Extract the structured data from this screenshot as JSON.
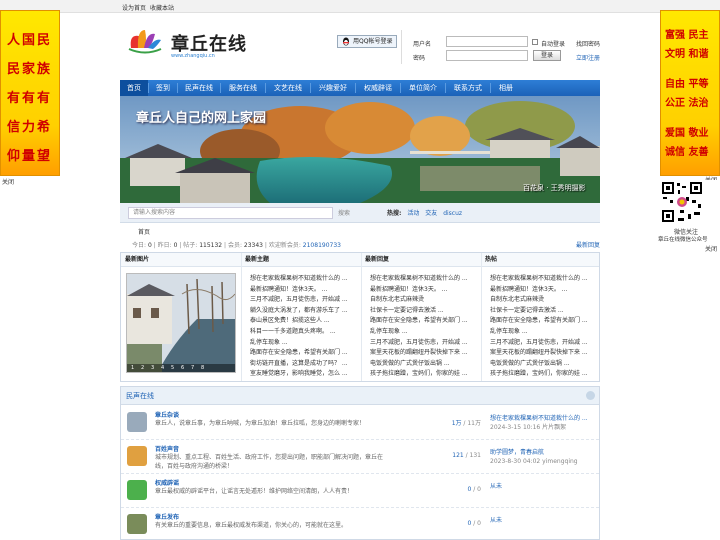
{
  "topbar": {
    "set_home": "设为首页",
    "bookmark": "收藏本站"
  },
  "ad_left": {
    "lines": [
      "人国民",
      "民家族",
      "有有有",
      "信力希",
      "仰量望"
    ],
    "close": "关闭"
  },
  "ad_right": {
    "lines": [
      "富强 民主",
      "文明 和谐",
      "自由 平等",
      "公正 法治",
      "爱国 敬业",
      "诚信 友善"
    ],
    "close": "关闭"
  },
  "logo": {
    "name": "章丘在线",
    "url": "www.zhangqiu.cn"
  },
  "login": {
    "qq_button": "用QQ帐号登录",
    "username_label": "用户名",
    "password_label": "密码",
    "auto_login": "自动登录",
    "find_password": "找回密码",
    "login_button": "登录",
    "register": "立即注册"
  },
  "nav": [
    "首页",
    "签到",
    "民声在线",
    "服务在线",
    "文艺在线",
    "兴趣爱好",
    "权威辟谣",
    "单位简介",
    "联系方式",
    "相册"
  ],
  "banner": {
    "title": "章丘人自己的网上家园",
    "caption": "百花泉 · 王秀明摄影"
  },
  "search": {
    "placeholder": "请输入搜索内容",
    "button": "搜索",
    "hot_label": "热搜:",
    "hot": [
      "活动",
      "交友",
      "discuz"
    ]
  },
  "breadcrumb": "首页",
  "stats": {
    "today_label": "今日:",
    "today": "0",
    "yesterday_label": "昨日:",
    "yesterday": "0",
    "posts_label": "帖子:",
    "posts": "115132",
    "members_label": "会员:",
    "members": "23343",
    "welcome_label": "欢迎新会员:",
    "newest": "2108190733"
  },
  "latest_reply_link": "最新回复",
  "panel": {
    "col1": "最新图片",
    "col2": "最新主题",
    "col3": "最新回复",
    "col4": "热帖",
    "pager": [
      "1",
      "2",
      "3",
      "4",
      "5",
      "6",
      "7",
      "8"
    ],
    "topics": [
      "想在老家栽棵果树不知道栽什么的 ...",
      "最新招聘通知！连休3天。 ...",
      "三月不减肥，五月徒伤悲，开始减 ...",
      "躺久没庭大涡发了，都有游乐车了 ...",
      "泰山景区免费！招揽这些人 ...",
      "科目一一千多道题真头疼啊。 ...",
      "乱停车现象 ...",
      "路面存在安全隐患，希望有关部门 ...",
      "街坊链开直播，这算是成功了吗？ ...",
      "室友睡觉磨牙，影响我睡觉，怎么 ..."
    ],
    "replies": [
      "想在老家栽棵果树不知道栽什么的 ...",
      "最新招聘通知！连休3天。 ...",
      "自制东北老式麻辣烫",
      "社保卡一定要记得去激活 ...",
      "路面存在安全隐患，希望有关部门 ...",
      "乱停车现象 ...",
      "三月不减肥，五月徒伤悲，开始减 ...",
      "案里天花板的蹋翻纽丹裂快掉下来 ...",
      "电饭煲做的广式煲仔饭出锅 ...",
      "孩子拖拉磨蹭，宝妈们，你家的娃 ..."
    ],
    "hot": [
      "想在老家栽棵果树不知道栽什么的 ...",
      "最新招聘通知！连休3天。 ...",
      "自制东北老式麻辣烫",
      "社保卡一定要记得去激活 ...",
      "路面存在安全隐患，希望有关部门 ...",
      "乱停车现象 ...",
      "三月不减肥，五月徒伤悲，开始减 ...",
      "案里天花板的蹋翻纽丹裂快掉下来 ...",
      "电饭煲做的广式煲仔饭出锅 ...",
      "孩子拖拉磨蹭，宝妈们，你家的娃 ..."
    ]
  },
  "forum": {
    "section": "民声在线",
    "boards": [
      {
        "name": "章丘杂谈",
        "desc": "章丘人，说章丘事，为章丘呐喊，为章丘加油！章丘拉呱，您身边的喇喇专家！",
        "count_a": "1万",
        "count_b": "11万",
        "last_title": "想在老家栽棵果树不知道栽什么的 ...",
        "last_time": "2024-3-15 10:16 片片飘絮",
        "icon": "chat-icon",
        "color": "#9ab"
      },
      {
        "name": "百姓声音",
        "desc": "城市规划、重点工程、百姓生活、政府工作，您提出问题，职能部门解决问题，章丘在线，百姓与政府沟通的桥梁！",
        "count_a": "121",
        "count_b": "131",
        "last_title": "助学圆梦，青春启航",
        "last_time": "2023-8-30 04:02 yimengqing",
        "icon": "pencil-icon",
        "color": "#e0a040"
      },
      {
        "name": "权威辟谣",
        "desc": "章丘最权威的辟谣平台，让谣言无处遁形！维护网络空间清朗，人人有责！",
        "count_a": "0",
        "count_b": "0",
        "last_title": "从未",
        "last_time": "",
        "icon": "speech-bubble-icon",
        "color": "#4cb04c"
      },
      {
        "name": "章丘发布",
        "desc": "有关章丘的重要信息，章丘最权威发布渠道，你关心的，可能就在这里。",
        "count_a": "0",
        "count_b": "0",
        "last_title": "从未",
        "last_time": "",
        "icon": "document-icon",
        "color": "#7a8c5a"
      }
    ]
  },
  "qr": {
    "line1": "微信关注",
    "line2": "章丘在线微信公众号",
    "close": "关闭"
  }
}
